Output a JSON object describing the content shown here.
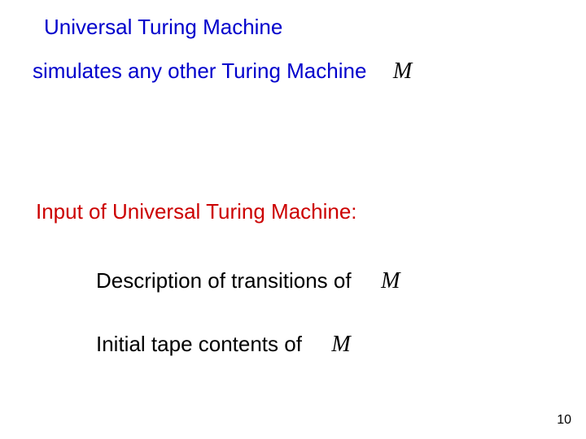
{
  "title": "Universal Turing Machine",
  "subtitle_prefix": "simulates any other Turing Machine",
  "symbol_M": "M",
  "input_heading": "Input of  Universal Turing Machine:",
  "item1": "Description of transitions of",
  "item2": "Initial tape contents of",
  "page_number": "10"
}
